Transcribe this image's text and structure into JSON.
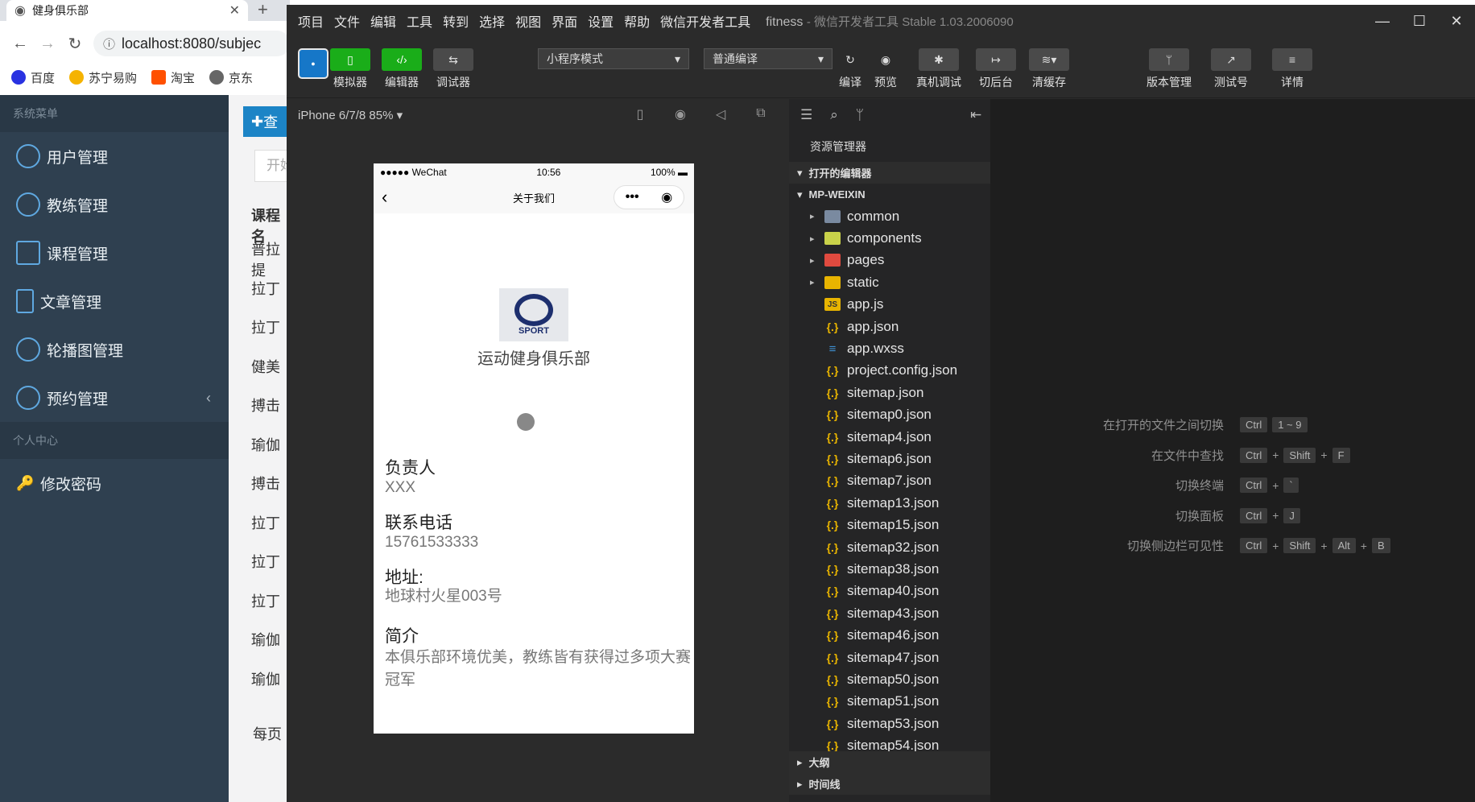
{
  "browser": {
    "tab_title": "健身俱乐部",
    "url": "localhost:8080/subjec",
    "bookmarks": [
      "百度",
      "苏宁易购",
      "淘宝",
      "京东"
    ]
  },
  "admin": {
    "section_system": "系统菜单",
    "menu": [
      "用户管理",
      "教练管理",
      "课程管理",
      "文章管理",
      "轮播图管理",
      "预约管理"
    ],
    "section_personal": "个人中心",
    "change_password": "修改密码",
    "query_button": "查",
    "input_placeholder": "开始",
    "table_header": "课程名",
    "rows": [
      "普拉提",
      "拉丁",
      "拉丁",
      "健美",
      "搏击",
      "瑜伽",
      "搏击",
      "拉丁",
      "拉丁",
      "拉丁",
      "瑜伽",
      "瑜伽"
    ],
    "footer": "每页"
  },
  "devtools": {
    "menu": [
      "项目",
      "文件",
      "编辑",
      "工具",
      "转到",
      "选择",
      "视图",
      "界面",
      "设置",
      "帮助",
      "微信开发者工具"
    ],
    "project_name": "fitness",
    "app_title": "- 微信开发者工具 Stable 1.03.2006090",
    "toolbar": {
      "simulator": "模拟器",
      "editor": "编辑器",
      "debugger": "调试器",
      "mode": "小程序模式",
      "compile_mode": "普通编译",
      "compile": "编译",
      "preview": "预览",
      "remote_debug": "真机调试",
      "background": "切后台",
      "clear_cache": "清缓存",
      "version": "版本管理",
      "test_account": "测试号",
      "details": "详情"
    },
    "device": "iPhone 6/7/8 85% ▾",
    "phone": {
      "carrier": "●●●●● WeChat",
      "time": "10:56",
      "battery": "100%",
      "nav_title": "关于我们",
      "logo_text": "SPORT",
      "club_name": "运动健身俱乐部",
      "person_label": "负责人",
      "person_value": "XXX",
      "phone_label": "联系电话",
      "phone_value": "15761533333",
      "address_label": "地址:",
      "address_value": "地球村火星003号",
      "intro_label": "简介",
      "intro_value": "本俱乐部环境优美，教练皆有获得过多项大赛冠军"
    },
    "explorer": {
      "title": "资源管理器",
      "open_editors": "打开的编辑器",
      "project": "MP-WEIXIN",
      "folders": [
        "common",
        "components",
        "pages",
        "static"
      ],
      "files": [
        "app.js",
        "app.json",
        "app.wxss",
        "project.config.json",
        "sitemap.json",
        "sitemap0.json",
        "sitemap4.json",
        "sitemap6.json",
        "sitemap7.json",
        "sitemap13.json",
        "sitemap15.json",
        "sitemap32.json",
        "sitemap38.json",
        "sitemap40.json",
        "sitemap43.json",
        "sitemap46.json",
        "sitemap47.json",
        "sitemap50.json",
        "sitemap51.json",
        "sitemap53.json",
        "sitemap54.json"
      ],
      "outline": "大纲",
      "timeline": "时间线"
    },
    "shortcuts": [
      {
        "label": "在打开的文件之间切换",
        "keys": [
          "Ctrl",
          "1 ~ 9"
        ]
      },
      {
        "label": "在文件中查找",
        "keys": [
          "Ctrl",
          "+",
          "Shift",
          "+",
          "F"
        ]
      },
      {
        "label": "切换终端",
        "keys": [
          "Ctrl",
          "+",
          "`"
        ]
      },
      {
        "label": "切换面板",
        "keys": [
          "Ctrl",
          "+",
          "J"
        ]
      },
      {
        "label": "切换侧边栏可见性",
        "keys": [
          "Ctrl",
          "+",
          "Shift",
          "+",
          "Alt",
          "+",
          "B"
        ]
      }
    ]
  }
}
